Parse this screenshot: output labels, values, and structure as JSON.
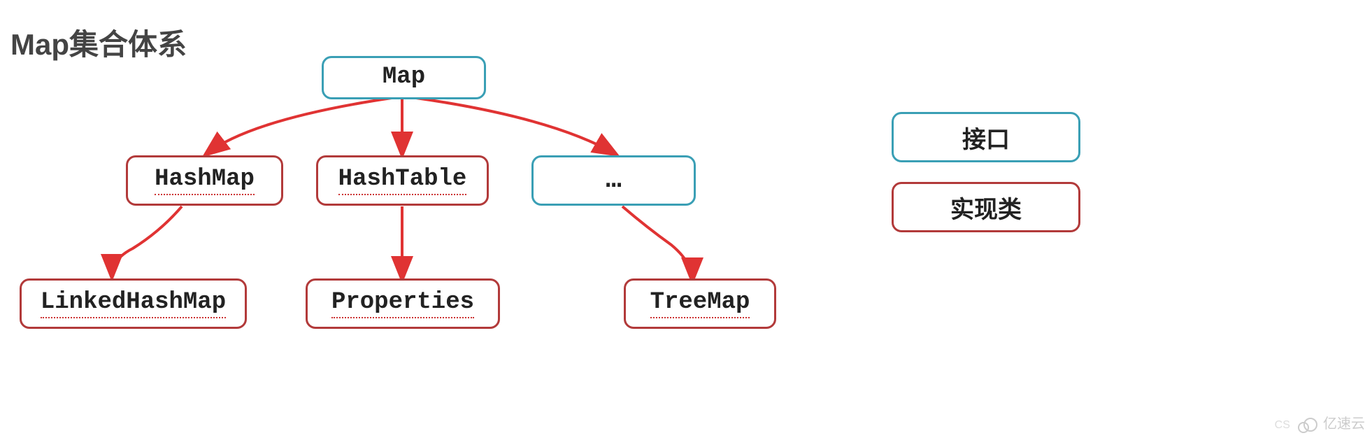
{
  "title": "Map集合体系",
  "nodes": {
    "map": {
      "label": "Map"
    },
    "hashmap": {
      "label": "HashMap"
    },
    "hashtable": {
      "label": "HashTable"
    },
    "ellipsis": {
      "label": "…"
    },
    "linkedhashmap": {
      "label": "LinkedHashMap"
    },
    "properties": {
      "label": "Properties"
    },
    "treemap": {
      "label": "TreeMap"
    }
  },
  "legend": {
    "interface": "接口",
    "class": "实现类"
  },
  "edges": [
    {
      "from": "map",
      "to": "hashmap"
    },
    {
      "from": "map",
      "to": "hashtable"
    },
    {
      "from": "map",
      "to": "ellipsis"
    },
    {
      "from": "hashmap",
      "to": "linkedhashmap"
    },
    {
      "from": "hashtable",
      "to": "properties"
    },
    {
      "from": "ellipsis",
      "to": "treemap"
    }
  ],
  "colors": {
    "interface_border": "#3a9fb5",
    "class_border": "#b23a3a",
    "arrow": "#e03333"
  },
  "watermark": "亿速云",
  "csdn_mark": "CS"
}
